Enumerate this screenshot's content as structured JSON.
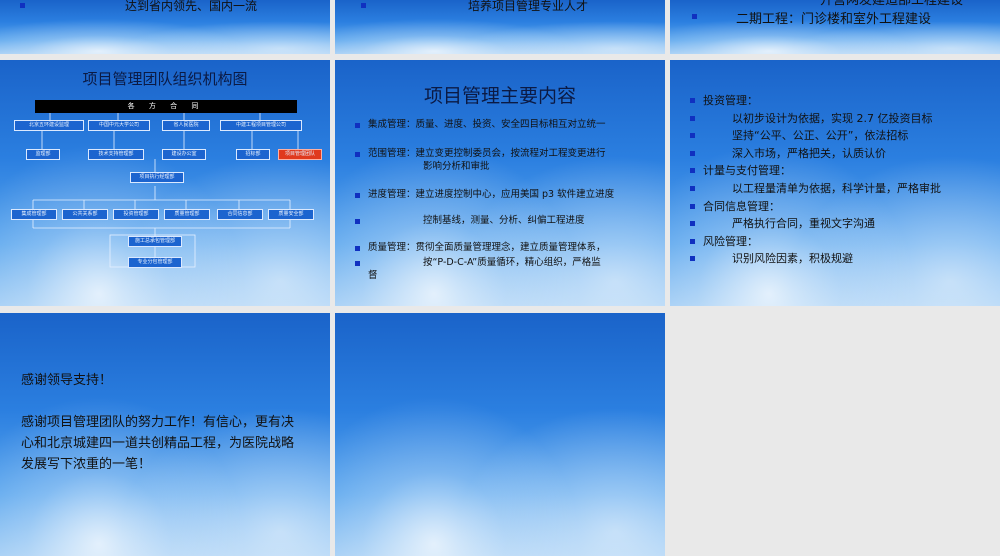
{
  "slides": {
    "s1": {
      "text": "达到省内领先、国内一流"
    },
    "s2": {
      "text": "培养项目管理专业人才"
    },
    "s3": {
      "text_partial": "开营网发建造部工程建设",
      "text": "二期工程：门诊楼和室外工程建设"
    },
    "org": {
      "title": "项目管理团队组织机构图",
      "contract_bar": "各 方 合 同",
      "row1": [
        "北京五环建设监理",
        "中国中元大学公司",
        "省人民医院",
        "中建工程项目管理公司"
      ],
      "row2": [
        "监理部",
        "技术支持管理部",
        "建设办公室",
        "招标部",
        "项目管理团队"
      ],
      "exec": "项目执行经理部",
      "row3": [
        "集成管理部",
        "公共关系部",
        "投资管理部",
        "质量管理部",
        "合同信息部",
        "质量安全部"
      ],
      "bottom1": "施工总承包管理部",
      "bottom2": "专业分包管理部"
    },
    "content": {
      "title": "项目管理主要内容",
      "items": [
        {
          "label": "集成管理：质量、进度、投资、安全四目标相互对立统一"
        },
        {
          "label": "范围管理：建立变更控制委员会，按流程对工程变更进行",
          "sub": "影响分析和审批"
        },
        {
          "label": "进度管理：建立进度控制中心，应用美国 p3 软件建立进度",
          "sub": "控制基线，测量、分析、纠偏工程进度"
        },
        {
          "label": "质量管理：贯彻全面质量管理理念，建立质量管理体系，",
          "sub": "按“P-D-C-A”质量循环，精心组织，严格监",
          "tail": "督"
        }
      ]
    },
    "mgmt": {
      "lines": [
        {
          "text": "投资管理：",
          "indent": false
        },
        {
          "text": "以初步设计为依据，实现 2.7 亿投资目标",
          "indent": true
        },
        {
          "text": "坚持“公平、公正、公开”，依法招标",
          "indent": true
        },
        {
          "text": "深入市场，严格把关，认质认价",
          "indent": true
        },
        {
          "text": "计量与支付管理：",
          "indent": false
        },
        {
          "text": "以工程量清单为依据，科学计量，严格审批",
          "indent": true
        },
        {
          "text": "合同信息管理：",
          "indent": false
        },
        {
          "text": "严格执行合同，重视文字沟通",
          "indent": true
        },
        {
          "text": "风险管理：",
          "indent": false
        },
        {
          "text": "识别风险因素，积极规避",
          "indent": true
        }
      ]
    },
    "thanks": {
      "line1": "感谢领导支持！",
      "line2": "感谢项目管理团队的努力工作！有信心，更有决心和北京城建四一道共创精品工程，为医院战略发展写下浓重的一笔！"
    }
  },
  "colors": {
    "bullet": "#1030c0",
    "highlight_box": "#e03a1e",
    "sky_top": "#1a63c9",
    "sky_bottom": "#9ccaf4"
  }
}
